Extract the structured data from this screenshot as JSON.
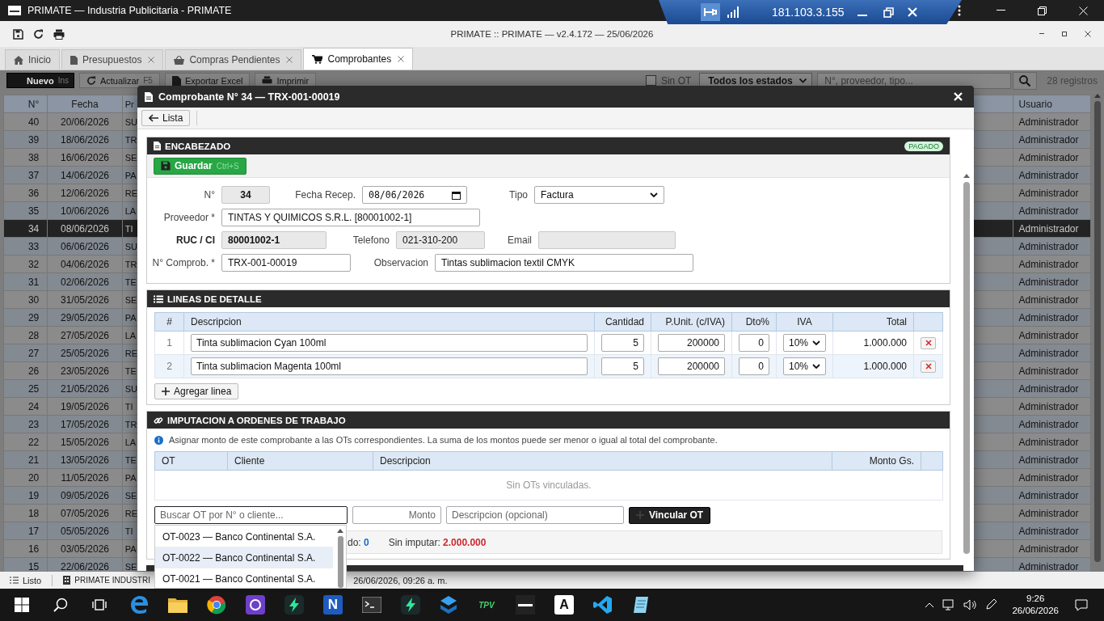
{
  "window": {
    "title": "PRIMATE — Industria Publicitaria - PRIMATE"
  },
  "remote_bar": {
    "address": "181.103.3.155"
  },
  "app_title": "PRIMATE :: PRIMATE — v2.4.172 — 25/06/2026",
  "tabs": [
    {
      "label": "Inicio",
      "kind": "home",
      "closable": false,
      "selected": false
    },
    {
      "label": "Presupuestos",
      "kind": "doc",
      "closable": true,
      "selected": false
    },
    {
      "label": "Compras Pendientes",
      "kind": "basket",
      "closable": true,
      "selected": false
    },
    {
      "label": "Comprobantes",
      "kind": "cart",
      "closable": true,
      "selected": true
    }
  ],
  "toolbar": {
    "buttons": [
      {
        "label": "Nuevo",
        "shortcut": "Ins",
        "kind": "new"
      },
      {
        "label": "Actualizar",
        "shortcut": "F5",
        "kind": "refresh"
      },
      {
        "label": "Exportar Excel",
        "kind": "export"
      },
      {
        "label": "Imprimir",
        "kind": "print"
      }
    ],
    "sin_ot": {
      "label": "Sin OT",
      "checked": false
    },
    "status_filter": "Todos los estados",
    "search_placeholder": "N°, proveedor, tipo...",
    "count": "28 registros"
  },
  "list": {
    "columns": [
      "N°",
      "Fecha",
      "Pr",
      "Usuario"
    ],
    "rows": [
      {
        "n": "40",
        "fecha": "20/06/2026",
        "col3": "SU",
        "usuario": "Administrador",
        "selected": false
      },
      {
        "n": "39",
        "fecha": "18/06/2026",
        "col3": "TR",
        "usuario": "Administrador",
        "selected": false
      },
      {
        "n": "38",
        "fecha": "16/06/2026",
        "col3": "SE",
        "usuario": "Administrador",
        "selected": false
      },
      {
        "n": "37",
        "fecha": "14/06/2026",
        "col3": "PA",
        "usuario": "Administrador",
        "selected": false
      },
      {
        "n": "36",
        "fecha": "12/06/2026",
        "col3": "RE",
        "usuario": "Administrador",
        "selected": false
      },
      {
        "n": "35",
        "fecha": "10/06/2026",
        "col3": "LA",
        "usuario": "Administrador",
        "selected": false
      },
      {
        "n": "34",
        "fecha": "08/06/2026",
        "col3": "TI",
        "usuario": "Administrador",
        "selected": true
      },
      {
        "n": "33",
        "fecha": "06/06/2026",
        "col3": "SU",
        "usuario": "Administrador",
        "selected": false
      },
      {
        "n": "32",
        "fecha": "04/06/2026",
        "col3": "TR",
        "usuario": "Administrador",
        "selected": false
      },
      {
        "n": "31",
        "fecha": "02/06/2026",
        "col3": "TE",
        "usuario": "Administrador",
        "selected": false
      },
      {
        "n": "30",
        "fecha": "31/05/2026",
        "col3": "SE",
        "usuario": "Administrador",
        "selected": false
      },
      {
        "n": "29",
        "fecha": "29/05/2026",
        "col3": "PA",
        "usuario": "Administrador",
        "selected": false
      },
      {
        "n": "28",
        "fecha": "27/05/2026",
        "col3": "LA",
        "usuario": "Administrador",
        "selected": false
      },
      {
        "n": "27",
        "fecha": "25/05/2026",
        "col3": "RE",
        "usuario": "Administrador",
        "selected": false
      },
      {
        "n": "26",
        "fecha": "23/05/2026",
        "col3": "TE",
        "usuario": "Administrador",
        "selected": false
      },
      {
        "n": "25",
        "fecha": "21/05/2026",
        "col3": "SU",
        "usuario": "Administrador",
        "selected": false
      },
      {
        "n": "24",
        "fecha": "19/05/2026",
        "col3": "TI",
        "usuario": "Administrador",
        "selected": false
      },
      {
        "n": "23",
        "fecha": "17/05/2026",
        "col3": "TR",
        "usuario": "Administrador",
        "selected": false
      },
      {
        "n": "22",
        "fecha": "15/05/2026",
        "col3": "LA",
        "usuario": "Administrador",
        "selected": false
      },
      {
        "n": "21",
        "fecha": "13/05/2026",
        "col3": "TE",
        "usuario": "Administrador",
        "selected": false
      },
      {
        "n": "20",
        "fecha": "11/05/2026",
        "col3": "PA",
        "usuario": "Administrador",
        "selected": false
      },
      {
        "n": "19",
        "fecha": "09/05/2026",
        "col3": "SE",
        "usuario": "Administrador",
        "selected": false
      },
      {
        "n": "18",
        "fecha": "07/05/2026",
        "col3": "RE",
        "usuario": "Administrador",
        "selected": false
      },
      {
        "n": "17",
        "fecha": "05/05/2026",
        "col3": "TI",
        "usuario": "Administrador",
        "selected": false
      },
      {
        "n": "16",
        "fecha": "03/05/2026",
        "col3": "PA",
        "usuario": "Administrador",
        "selected": false
      },
      {
        "n": "15",
        "fecha": "22/06/2026",
        "col3": "SE",
        "usuario": "Administrador",
        "selected": false
      }
    ]
  },
  "modal": {
    "title": "Comprobante N° 34 — TRX-001-00019",
    "back": "Lista",
    "header_section": {
      "title": "ENCABEZADO",
      "status": {
        "label": "PAGADO",
        "kind": "paid"
      },
      "save": {
        "label": "Guardar",
        "shortcut": "Ctrl+S"
      },
      "rows": [
        [
          {
            "label": "N°",
            "value": "34",
            "kind": "readonly"
          },
          {
            "label": "Fecha Recep.",
            "value": "08/06/2026",
            "kind": "date"
          },
          {
            "label": "Tipo",
            "value": "Factura",
            "kind": "select"
          }
        ],
        [
          {
            "label": "Proveedor *",
            "value": "TINTAS Y QUIMICOS S.R.L. [80001002-1]",
            "kind": "text"
          }
        ],
        [
          {
            "label": "RUC / CI",
            "value": "80001002-1",
            "kind": "readonly",
            "strong": true
          },
          {
            "label": "Telefono",
            "value": "021-310-200",
            "kind": "readonly"
          },
          {
            "label": "Email",
            "kind": "readonly"
          }
        ],
        [
          {
            "label": "N° Comprob. *",
            "value": "TRX-001-00019",
            "kind": "text"
          },
          {
            "label": "Observacion",
            "value": "Tintas sublimacion textil CMYK",
            "kind": "text"
          }
        ]
      ]
    },
    "lines_section": {
      "title": "LINEAS DE DETALLE",
      "columns": [
        "#",
        "Descripcion",
        "Cantidad",
        "P.Unit. (c/IVA)",
        "Dto%",
        "IVA",
        "Total"
      ],
      "rows": [
        {
          "index": "1",
          "descripcion": "Tinta sublimacion Cyan 100ml",
          "cantidad": "5",
          "punit": "200000",
          "dto": "0",
          "iva": "10%",
          "total": "1.000.000"
        },
        {
          "index": "2",
          "descripcion": "Tinta sublimacion Magenta 100ml",
          "cantidad": "5",
          "punit": "200000",
          "dto": "0",
          "iva": "10%",
          "total": "1.000.000"
        }
      ],
      "add": "Agregar linea"
    },
    "ot_section": {
      "title": "IMPUTACION A ORDENES DE TRABAJO",
      "info": "Asignar monto de este comprobante a las OTs correspondientes. La suma de los montos puede ser menor o igual al total del comprobante.",
      "columns": [
        "OT",
        "Cliente",
        "Descripcion",
        "Monto Gs."
      ],
      "empty": "Sin OTs vinculadas.",
      "search_placeholder": "Buscar OT por N° o cliente...",
      "amount_placeholder": "Monto",
      "desc_placeholder": "Descripcion (opcional)",
      "link_button": "Vincular OT",
      "summary": [
        {
          "label": "do:",
          "value": "0",
          "kind": "info"
        },
        {
          "label": "Sin imputar:",
          "value": "2.000.000",
          "kind": "warn"
        }
      ],
      "suggestions": [
        {
          "label": "OT-0023 — Banco Continental S.A.",
          "selected": false
        },
        {
          "label": "OT-0022 — Banco Continental S.A.",
          "selected": true
        },
        {
          "label": "OT-0021 — Banco Continental S.A.",
          "selected": false
        }
      ]
    }
  },
  "status_bar": {
    "state": "Listo",
    "company": "PRIMATE INDUSTRI",
    "datetime": "26/06/2026, 09:26 a. m."
  },
  "taskbar": {
    "apps": [
      {
        "kind": "browser"
      },
      {
        "kind": "folder"
      },
      {
        "kind": "ring"
      },
      {
        "kind": "cat"
      },
      {
        "kind": "bolt"
      },
      {
        "kind": "letter",
        "label": "N"
      },
      {
        "kind": "terminal"
      },
      {
        "kind": "bolt"
      },
      {
        "kind": "stack"
      },
      {
        "kind": "text",
        "label": "TPV"
      },
      {
        "kind": "logo"
      },
      {
        "kind": "letter-dark",
        "label": "A"
      },
      {
        "kind": "code"
      },
      {
        "kind": "pad"
      }
    ],
    "time": "9:26",
    "date": "26/06/2026"
  }
}
